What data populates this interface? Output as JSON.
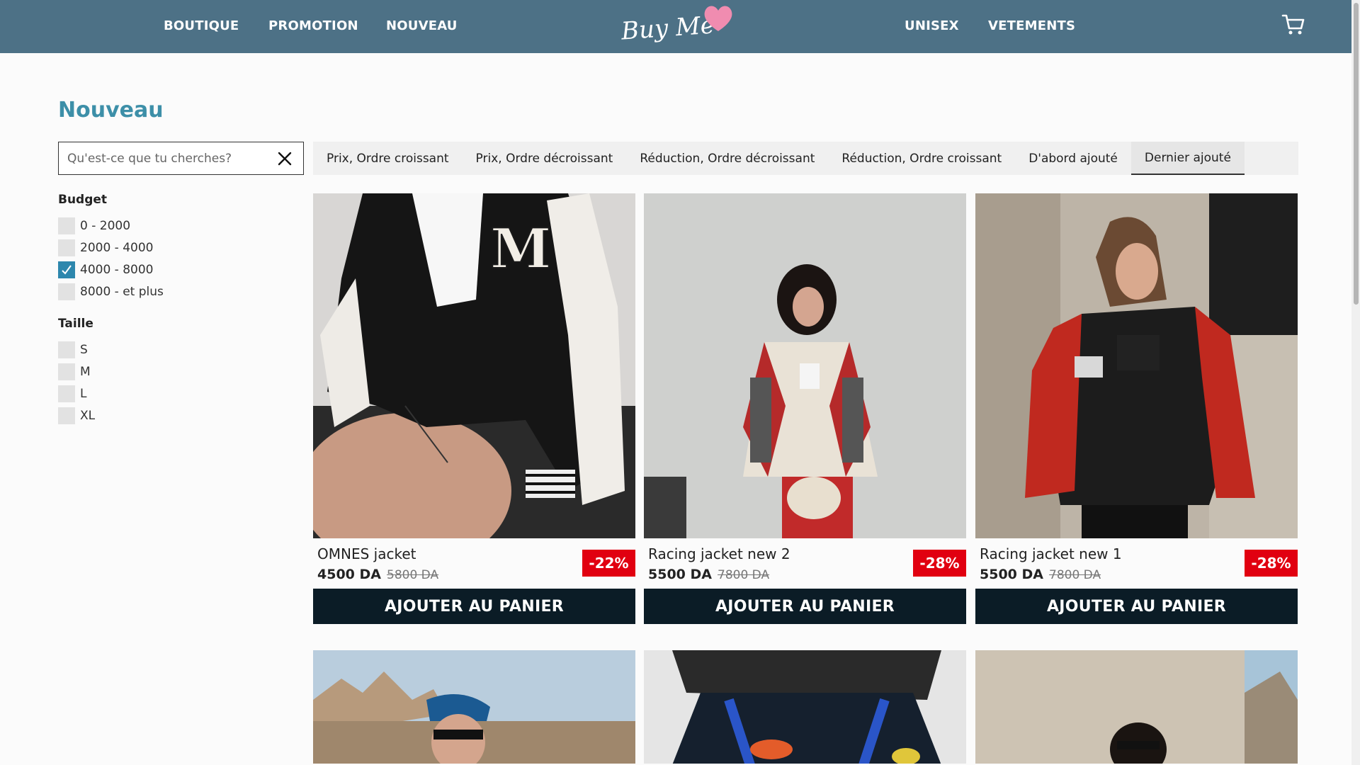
{
  "nav": {
    "left": [
      "BOUTIQUE",
      "PROMOTION",
      "NOUVEAU"
    ],
    "right": [
      "UNISEX",
      "VETEMENTS"
    ],
    "logo_text": "Buy Me",
    "cart_icon": "cart-icon"
  },
  "page_title": "Nouveau",
  "search": {
    "placeholder": "Qu'est-ce que tu cherches?",
    "value": ""
  },
  "filters": {
    "budget": {
      "title": "Budget",
      "options": [
        {
          "label": "0 - 2000",
          "checked": false
        },
        {
          "label": "2000 - 4000",
          "checked": false
        },
        {
          "label": "4000 - 8000",
          "checked": true
        },
        {
          "label": "8000 - et plus",
          "checked": false
        }
      ]
    },
    "size": {
      "title": "Taille",
      "options": [
        {
          "label": "S",
          "checked": false
        },
        {
          "label": "M",
          "checked": false
        },
        {
          "label": "L",
          "checked": false
        },
        {
          "label": "XL",
          "checked": false
        }
      ]
    }
  },
  "sort": {
    "tabs": [
      "Prix, Ordre croissant",
      "Prix, Ordre décroissant",
      "Réduction, Ordre décroissant",
      "Réduction, Ordre croissant",
      "D'abord ajouté",
      "Dernier ajouté"
    ],
    "active": 5
  },
  "products": [
    {
      "name": "OMNES jacket",
      "price": "4500 DA",
      "old_price": "5800 DA",
      "discount": "-22%",
      "button": "AJOUTER AU PANIER"
    },
    {
      "name": "Racing jacket new 2",
      "price": "5500 DA",
      "old_price": "7800 DA",
      "discount": "-28%",
      "button": "AJOUTER AU PANIER"
    },
    {
      "name": "Racing jacket new 1",
      "price": "5500 DA",
      "old_price": "7800 DA",
      "discount": "-28%",
      "button": "AJOUTER AU PANIER"
    }
  ],
  "colors": {
    "header": "#4d7186",
    "title": "#3d8fa8",
    "badge": "#e10010",
    "button": "#0b1c26",
    "checkbox_checked": "#2d87ad"
  }
}
